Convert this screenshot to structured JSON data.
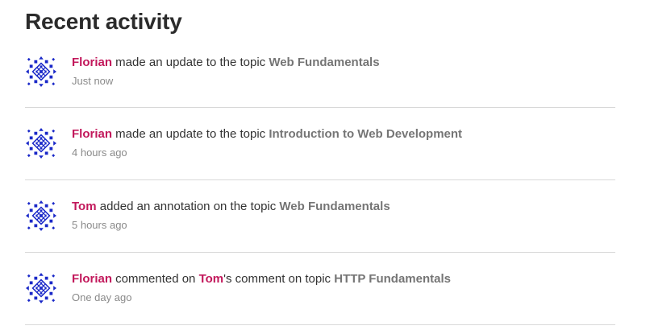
{
  "section": {
    "title": "Recent activity"
  },
  "colors": {
    "user_link": "#c2185b",
    "topic_link": "#757575",
    "avatar": "#1a28c8"
  },
  "activities": [
    {
      "user": "Florian",
      "action": " made an update to the topic ",
      "topic": "Web Fundamentals",
      "time": "Just now",
      "avatar_icon": "identicon-avatar"
    },
    {
      "user": "Florian",
      "action": " made an update to the topic ",
      "topic": "Introduction to Web Development",
      "time": "4 hours ago",
      "avatar_icon": "identicon-avatar"
    },
    {
      "user": "Tom",
      "action": " added an annotation on the topic ",
      "topic": "Web Fundamentals",
      "time": "5 hours ago",
      "avatar_icon": "identicon-avatar"
    },
    {
      "user": "Florian",
      "action": " commented on ",
      "target_user": "Tom",
      "action_suffix": "'s comment on topic ",
      "topic": "HTTP Fundamentals",
      "time": "One day ago",
      "avatar_icon": "identicon-avatar"
    }
  ]
}
